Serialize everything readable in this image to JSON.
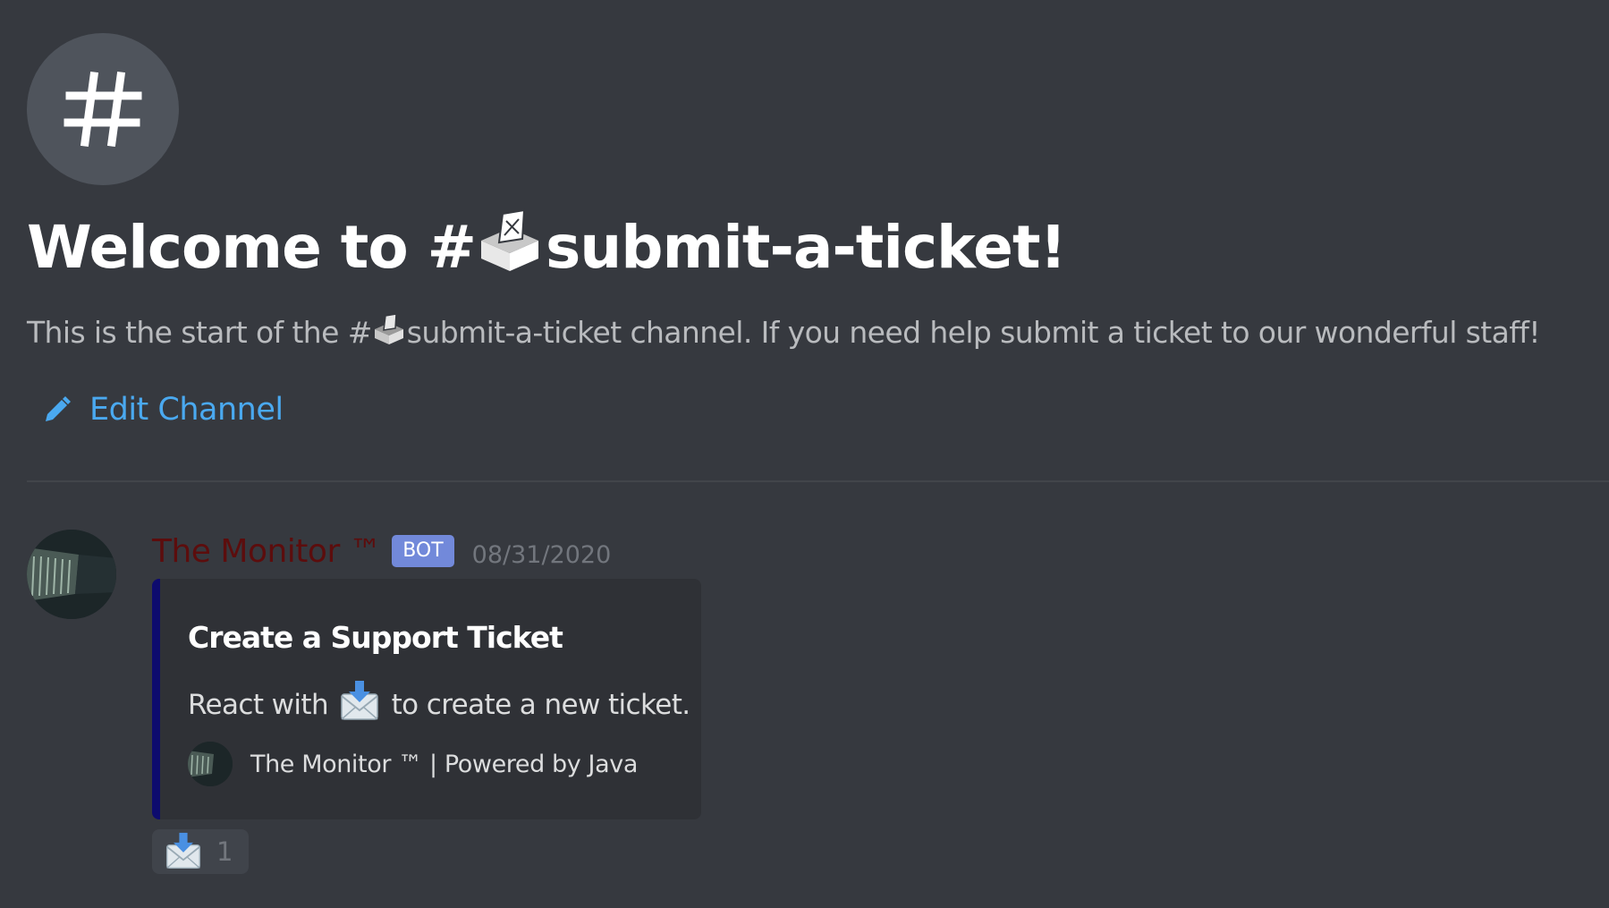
{
  "channel": {
    "welcome_prefix": "Welcome to #",
    "welcome_channel_name": "submit-a-ticket!",
    "desc_prefix": "This is the start of the #",
    "desc_suffix": "submit-a-ticket channel. If you need help submit a ticket to our wonderful staff!",
    "icon_name": "hash-icon",
    "emoji_name": "ballot-box-icon"
  },
  "edit_channel": {
    "label": "Edit Channel",
    "icon_name": "pencil-icon",
    "color": "#4aa9f0"
  },
  "message": {
    "author": "The Monitor ™",
    "author_color": "#5c0d0d",
    "bot_tag": "BOT",
    "bot_tag_color": "#7289da",
    "timestamp": "08/31/2020",
    "embed": {
      "accent_color": "#0d0b6e",
      "title": "Create a Support Ticket",
      "desc_prefix": "React with",
      "desc_suffix": "to create a new ticket.",
      "footer_text": "The Monitor ™ | Powered by Java"
    },
    "reaction": {
      "emoji_name": "envelope-with-arrow-icon",
      "count": "1"
    }
  },
  "theme": {
    "background": "#36393f",
    "embed_background": "#2f3136"
  }
}
